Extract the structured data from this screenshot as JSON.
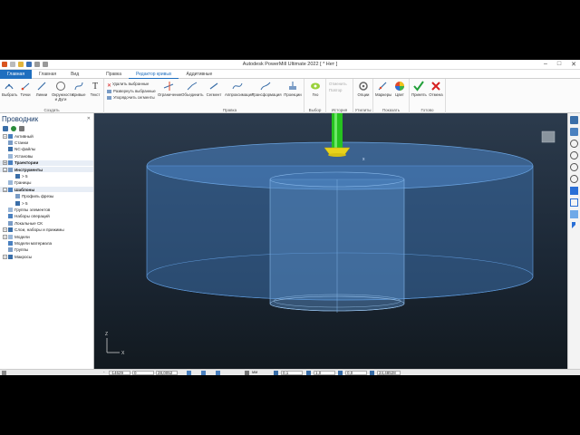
{
  "window": {
    "title": "Autodesk PowerMill Ultimate 2022   [ * Нет ]",
    "controls": [
      "–",
      "□",
      "✕"
    ]
  },
  "tabs": [
    {
      "label": "Главная",
      "active": false
    },
    {
      "label": "Вид",
      "active": false
    },
    {
      "label": "Правка",
      "active": false
    },
    {
      "label": "Редактор кривых",
      "active": true
    },
    {
      "label": "Аддитивные",
      "active": false
    }
  ],
  "ribbon": {
    "create": {
      "label": "Создать",
      "buttons": [
        "Выбрать",
        "Точки",
        "Линии",
        "Окружности и Дуги",
        "Кривые",
        "Текст"
      ]
    },
    "edit_small": [
      "Удалить выбранные",
      "Развернуть выбранные",
      "Упорядочить сегменты"
    ],
    "edit": {
      "label": "Правка",
      "buttons": [
        "Ограничение",
        "Объединить",
        "Сегмент",
        "Аппроксимация",
        "Трансформация",
        "Проекции"
      ]
    },
    "select": {
      "label": "Выбор",
      "buttons": [
        "Гео"
      ]
    },
    "history": {
      "label": "История",
      "items": [
        "Отменить",
        "Повтор"
      ]
    },
    "utilities": {
      "label": "Утилиты",
      "buttons": [
        "Опции"
      ]
    },
    "show": {
      "label": "Показать",
      "buttons": [
        "Маркеры",
        "Цвет"
      ]
    },
    "done": {
      "label": "Готово",
      "buttons": [
        "Принять",
        "Отмена"
      ]
    }
  },
  "explorer": {
    "title": "Проводник",
    "items": [
      {
        "label": "Активный",
        "level": 0,
        "expander": "+",
        "bold": false
      },
      {
        "label": "Станки",
        "level": 0,
        "expander": "",
        "bold": false
      },
      {
        "label": "NC-файлы",
        "level": 0,
        "expander": "",
        "bold": false
      },
      {
        "label": "Установы",
        "level": 0,
        "expander": "",
        "bold": false
      },
      {
        "label": "Траектории",
        "level": 0,
        "expander": "+",
        "bold": true
      },
      {
        "label": "Инструменты",
        "level": 0,
        "expander": "–",
        "bold": true
      },
      {
        "label": "> 5",
        "level": 1,
        "expander": "",
        "bold": false
      },
      {
        "label": "Границы",
        "level": 0,
        "expander": "",
        "bold": false
      },
      {
        "label": "Шаблоны",
        "level": 0,
        "expander": "–",
        "bold": true
      },
      {
        "label": "Профиль фрезы",
        "level": 1,
        "expander": "",
        "bold": false
      },
      {
        "label": "> 5",
        "level": 1,
        "expander": "",
        "bold": false
      },
      {
        "label": "Группы элементов",
        "level": 0,
        "expander": "",
        "bold": false
      },
      {
        "label": "Наборы операций",
        "level": 0,
        "expander": "",
        "bold": false
      },
      {
        "label": "Локальные СК",
        "level": 0,
        "expander": "",
        "bold": false
      },
      {
        "label": "Слои, наборы и прижимы",
        "level": 0,
        "expander": "+",
        "bold": false
      },
      {
        "label": "Модели",
        "level": 0,
        "expander": "+",
        "bold": false
      },
      {
        "label": "Модели материала",
        "level": 0,
        "expander": "",
        "bold": false
      },
      {
        "label": "Группы",
        "level": 0,
        "expander": "",
        "bold": false
      },
      {
        "label": "Макросы",
        "level": 0,
        "expander": "+",
        "bold": false
      }
    ]
  },
  "viewport": {
    "triad": {
      "z": "Z",
      "x": "X"
    },
    "body_color": "#3a6ea8",
    "tool_shank_color": "#26c21f",
    "tool_tip_color": "#e8d21a"
  },
  "statusbar": {
    "x": "-14629",
    "y": "0",
    "z": "28,0052",
    "units": "мм",
    "tolerance": "0,1",
    "stock": "1,0",
    "thickness": "0,0",
    "value": "24,48528"
  }
}
